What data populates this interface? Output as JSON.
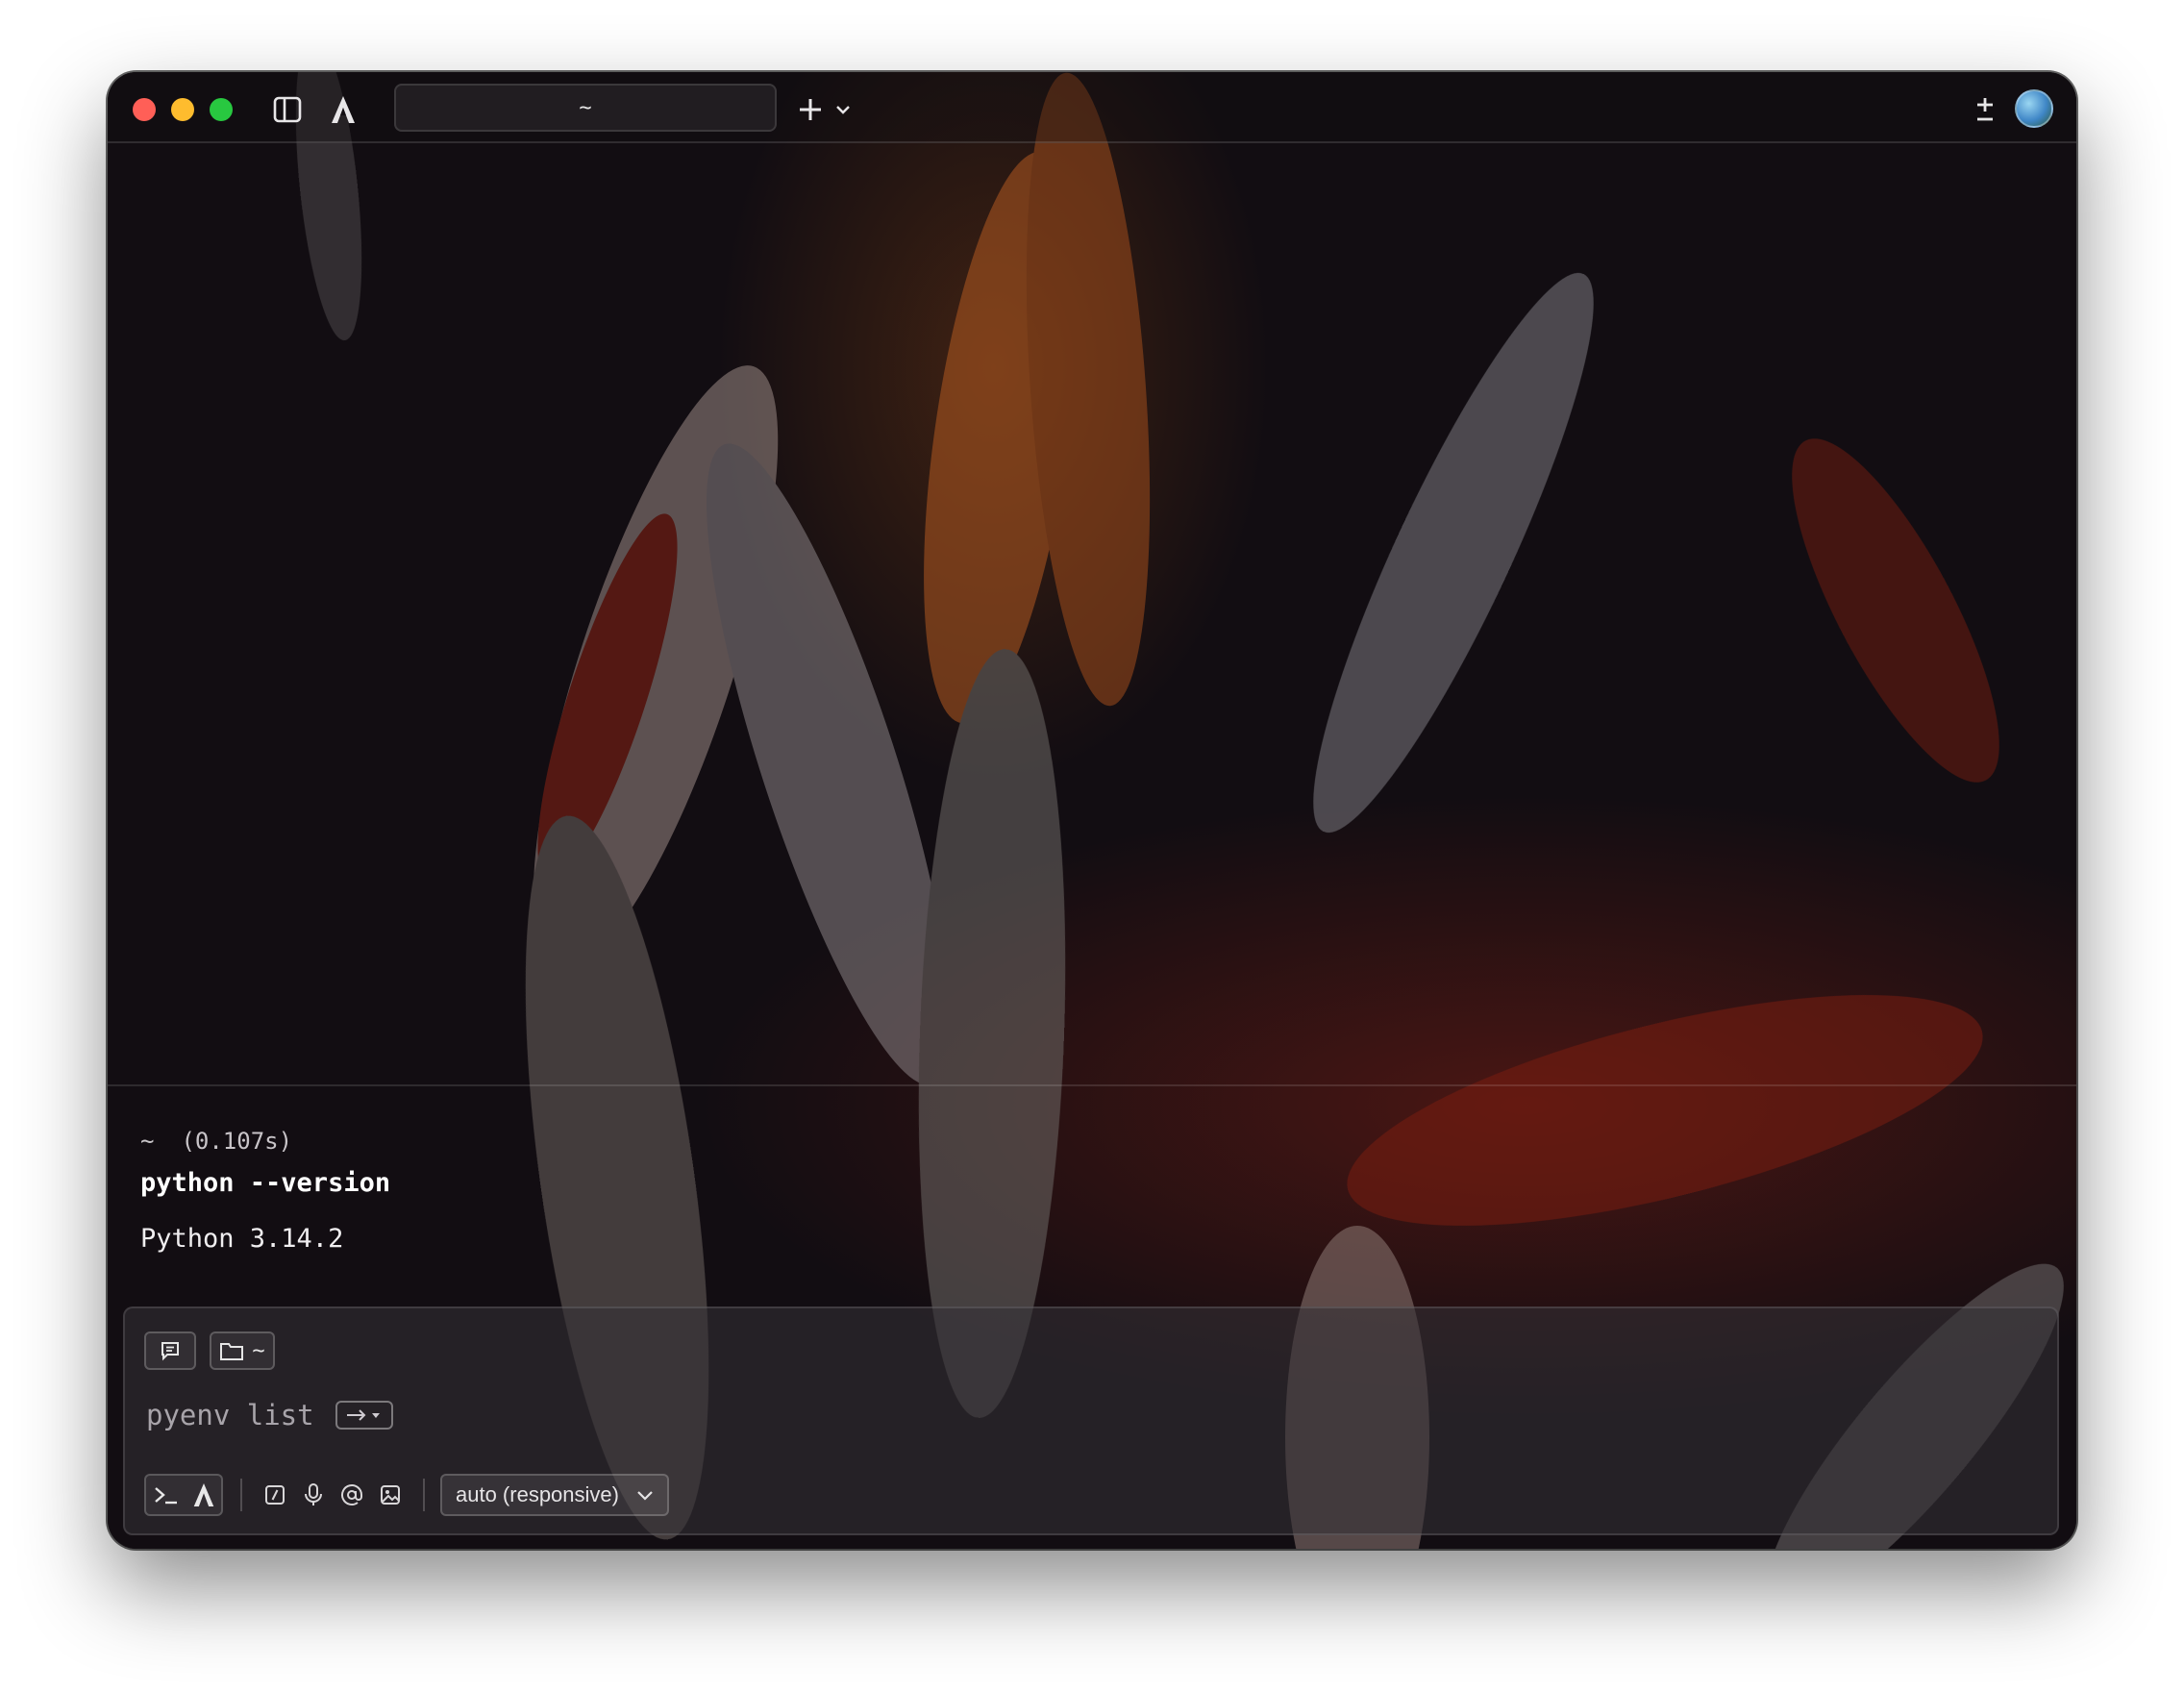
{
  "window": {
    "tab_title": "~",
    "traffic_lights": [
      "close",
      "minimize",
      "zoom"
    ]
  },
  "titlebar": {
    "icons": [
      "sidebar-toggle-icon",
      "warp-logo-icon",
      "plus-icon",
      "chevron-down-icon",
      "plus-minus-icon"
    ]
  },
  "block": {
    "cwd": "~",
    "duration": "(0.107s)",
    "command": "python --version",
    "output": "Python 3.14.2"
  },
  "input": {
    "cwd_chip": "~",
    "suggestion": "pyenv list",
    "model": "auto (responsive)"
  },
  "colors": {
    "close": "#ff5f57",
    "minimize": "#febc2e",
    "zoom": "#28c840"
  }
}
